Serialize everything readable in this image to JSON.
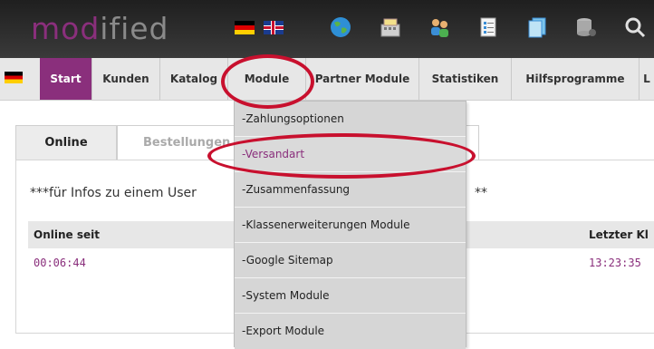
{
  "header": {
    "logo_part1": "mod",
    "logo_part2": "ified"
  },
  "nav": {
    "items": [
      {
        "label": "Start"
      },
      {
        "label": "Kunden"
      },
      {
        "label": "Katalog"
      },
      {
        "label": "Module"
      },
      {
        "label": "Partner Module"
      },
      {
        "label": "Statistiken"
      },
      {
        "label": "Hilfsprogramme"
      },
      {
        "label": "L"
      }
    ]
  },
  "tabs": [
    {
      "label": "Online"
    },
    {
      "label": "Bestellungen"
    }
  ],
  "content": {
    "info_left": "***für Infos zu einem User",
    "info_right": "**"
  },
  "table": {
    "headers": [
      "Online seit",
      "Letzter Kl"
    ],
    "rows": [
      [
        "00:06:44",
        "13:23:35"
      ]
    ]
  },
  "dropdown": {
    "items": [
      {
        "label": "-Zahlungsoptionen"
      },
      {
        "label": "-Versandart"
      },
      {
        "label": "-Zusammenfassung"
      },
      {
        "label": "-Klassenerweiterungen Module"
      },
      {
        "label": "-Google Sitemap"
      },
      {
        "label": "-System Module"
      },
      {
        "label": "-Export Module"
      }
    ]
  },
  "colors": {
    "accent": "#8a2f7c",
    "annotation": "#c8102e"
  }
}
